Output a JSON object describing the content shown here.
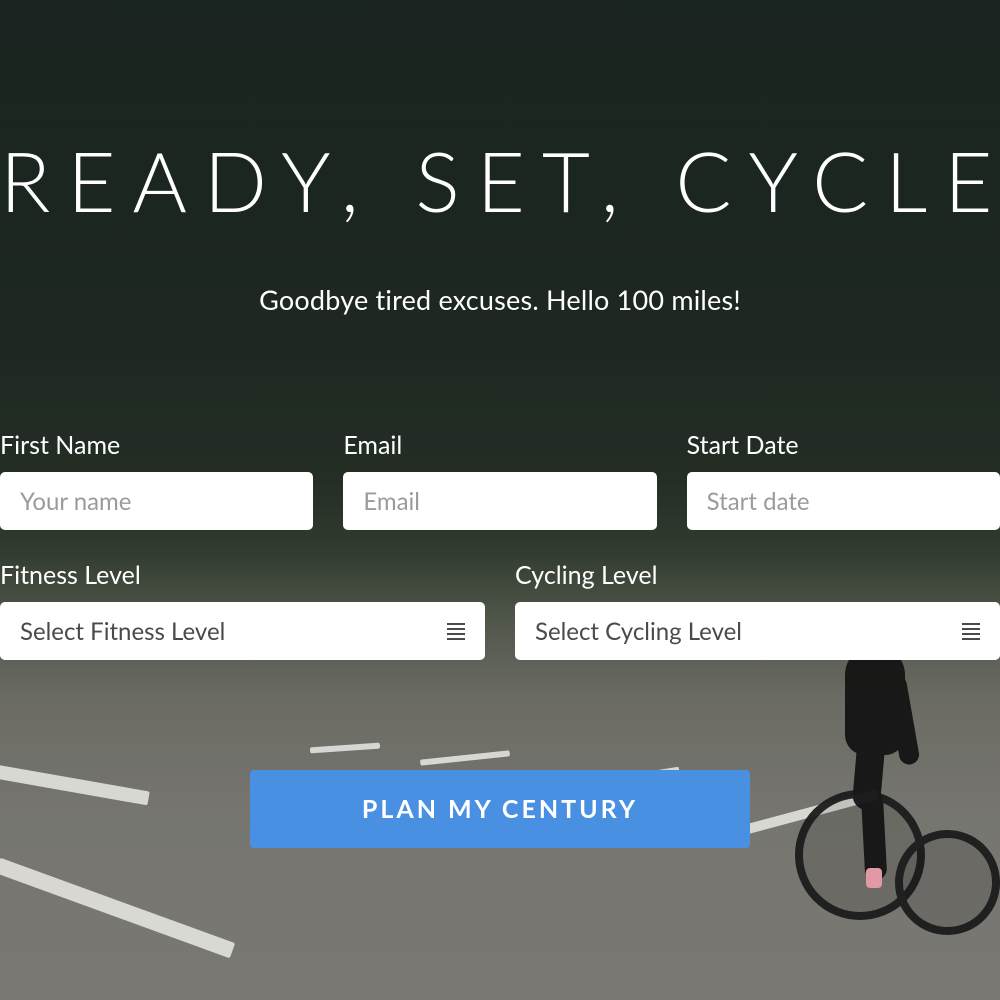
{
  "hero": {
    "headline": "READY, SET, CYCLE!",
    "subhead": "Goodbye tired excuses. Hello 100 miles!"
  },
  "form": {
    "first_name": {
      "label": "First Name",
      "placeholder": "Your name"
    },
    "email": {
      "label": "Email",
      "placeholder": "Email"
    },
    "start_date": {
      "label": "Start Date",
      "placeholder": "Start date"
    },
    "fitness_level": {
      "label": "Fitness Level",
      "selected": "Select Fitness Level"
    },
    "cycling_level": {
      "label": "Cycling Level",
      "selected": "Select Cycling Level"
    },
    "submit_label": "PLAN MY CENTURY"
  },
  "colors": {
    "accent": "#4a90e2",
    "text_on_dark": "#ffffff",
    "placeholder": "#9b9b9b"
  }
}
